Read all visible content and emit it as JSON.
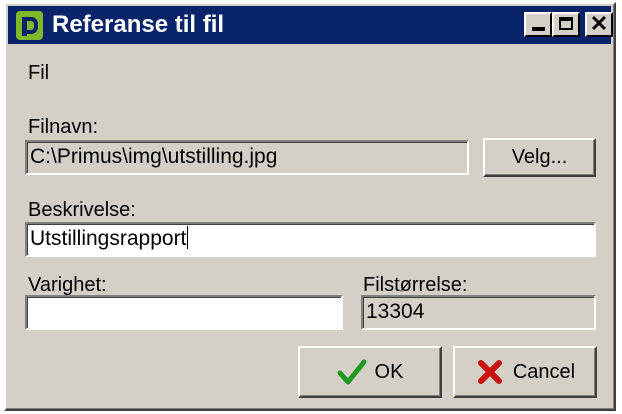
{
  "window": {
    "title": "Referanse til fil",
    "close_symbol": "✕"
  },
  "menu": {
    "items": [
      {
        "label": "Fil"
      }
    ]
  },
  "form": {
    "filename_label": "Filnavn:",
    "filename_value": "C:\\Primus\\img\\utstilling.jpg",
    "choose_button_label": "Velg...",
    "description_label": "Beskrivelse:",
    "description_value": "Utstillingsrapport",
    "duration_label": "Varighet:",
    "duration_value": "",
    "filesize_label": "Filstørrelse:",
    "filesize_value": "13304"
  },
  "buttons": {
    "ok_label": "OK",
    "cancel_label": "Cancel"
  },
  "colors": {
    "titlebar": "#0a246a",
    "dialog_face": "#d4d0c8",
    "logo_green": "#7fb82a",
    "ok_check": "#1f9a1f",
    "cancel_cross": "#cc1111"
  },
  "icons": {
    "app": "primus-logo-icon",
    "minimize": "minimize-icon",
    "maximize": "maximize-icon",
    "close": "close-icon",
    "ok": "checkmark-icon",
    "cancel": "cross-icon"
  }
}
